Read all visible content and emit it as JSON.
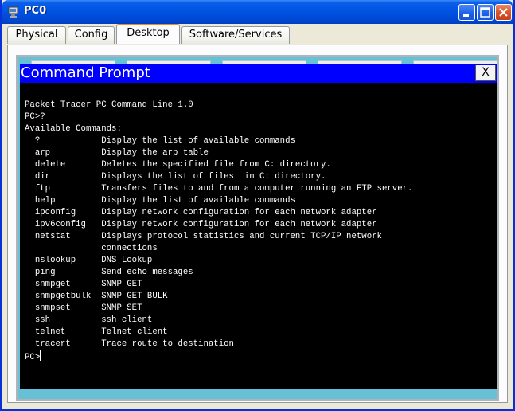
{
  "window": {
    "title": "PC0",
    "icon": "pc-icon",
    "controls": [
      "minimize-icon",
      "maximize-icon",
      "close-icon"
    ]
  },
  "tabs": [
    {
      "label": "Physical"
    },
    {
      "label": "Config"
    },
    {
      "label": "Desktop",
      "active": true
    },
    {
      "label": "Software/Services"
    }
  ],
  "command_prompt": {
    "title": "Command Prompt",
    "close_label": "X",
    "header_color": "#0000ff",
    "background_color": "#000000",
    "frame_color": "#66c0d6",
    "lines": [
      "Packet Tracer PC Command Line 1.0",
      "PC>?",
      "Available Commands:",
      "  ?            Display the list of available commands",
      "  arp          Display the arp table",
      "  delete       Deletes the specified file from C: directory.",
      "  dir          Displays the list of files  in C: directory.",
      "  ftp          Transfers files to and from a computer running an FTP server.",
      "  help         Display the list of available commands",
      "  ipconfig     Display network configuration for each network adapter",
      "  ipv6config   Display network configuration for each network adapter",
      "  netstat      Displays protocol statistics and current TCP/IP network",
      "               connections",
      "  nslookup     DNS Lookup",
      "  ping         Send echo messages",
      "  snmpget      SNMP GET",
      "  snmpgetbulk  SNMP GET BULK",
      "  snmpset      SNMP SET",
      "  ssh          ssh client",
      "  telnet       Telnet client",
      "  tracert      Trace route to destination"
    ],
    "prompt": "PC>"
  }
}
